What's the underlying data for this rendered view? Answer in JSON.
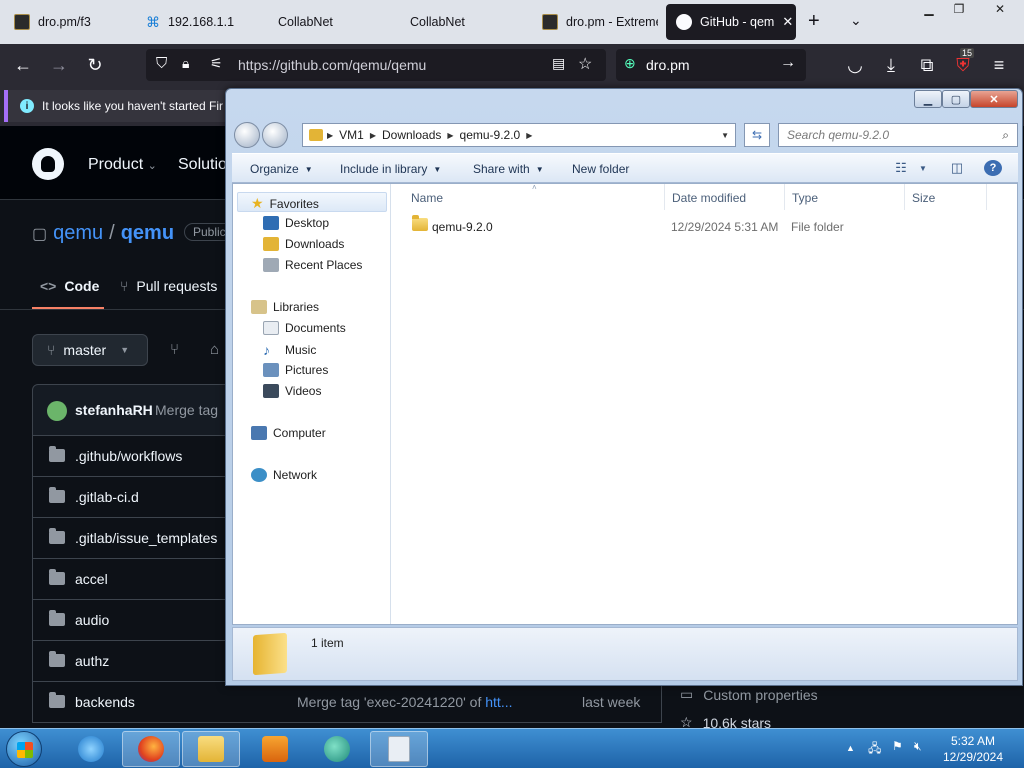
{
  "browser": {
    "tabs": [
      {
        "label": "dro.pm/f3"
      },
      {
        "label": "192.168.1.1"
      },
      {
        "label": "CollabNet"
      },
      {
        "label": "CollabNet"
      },
      {
        "label": "dro.pm - Extreme"
      },
      {
        "label": "GitHub - qem"
      }
    ],
    "url": "https://github.com/qemu/qemu",
    "search_value": "dro.pm",
    "extensions_badge": "15",
    "notice": "It looks like you haven't started Fir"
  },
  "github": {
    "nav": [
      "Product",
      "Solutio"
    ],
    "owner": "qemu",
    "repo": "qemu",
    "visibility": "Public",
    "tabs": [
      "Code",
      "Pull requests"
    ],
    "branch": "master",
    "commit_author": "stefanhaRH",
    "commit_message": "Merge tag",
    "files": [
      {
        "name": ".github/workflows",
        "commit": "",
        "link": "",
        "time": ""
      },
      {
        "name": ".gitlab-ci.d",
        "commit": "",
        "link": "",
        "time": ""
      },
      {
        "name": ".gitlab/issue_templates",
        "commit": "",
        "link": "",
        "time": ""
      },
      {
        "name": "accel",
        "commit": "",
        "link": "",
        "time": ""
      },
      {
        "name": "audio",
        "commit": "",
        "link": "",
        "time": ""
      },
      {
        "name": "authz",
        "commit": "",
        "link": "",
        "time": ""
      },
      {
        "name": "backends",
        "commit": "Merge tag 'exec-20241220' of ",
        "link": "htt...",
        "time": "last week"
      }
    ],
    "sidebar": {
      "custom_properties": "Custom properties",
      "stars": "10.6k stars"
    }
  },
  "explorer": {
    "breadcrumb": [
      "VM1",
      "Downloads",
      "qemu-9.2.0"
    ],
    "search_placeholder": "Search qemu-9.2.0",
    "toolbar": {
      "organize": "Organize",
      "include_in_library": "Include in library",
      "share_with": "Share with",
      "new_folder": "New folder"
    },
    "nav": {
      "favorites": "Favorites",
      "desktop": "Desktop",
      "downloads": "Downloads",
      "recent_places": "Recent Places",
      "libraries": "Libraries",
      "documents": "Documents",
      "music": "Music",
      "pictures": "Pictures",
      "videos": "Videos",
      "computer": "Computer",
      "network": "Network"
    },
    "columns": {
      "name": "Name",
      "date_modified": "Date modified",
      "type": "Type",
      "size": "Size"
    },
    "rows": [
      {
        "name": "qemu-9.2.0",
        "date_modified": "12/29/2024 5:31 AM",
        "type": "File folder",
        "size": ""
      }
    ],
    "item_count": "1 item"
  },
  "taskbar": {
    "time": "5:32 AM",
    "date": "12/29/2024"
  },
  "colors": {
    "github_link": "#4493f8",
    "tab_underline": "#f78166",
    "taskbar": "#2a72bd",
    "folder": "#e3b436"
  }
}
